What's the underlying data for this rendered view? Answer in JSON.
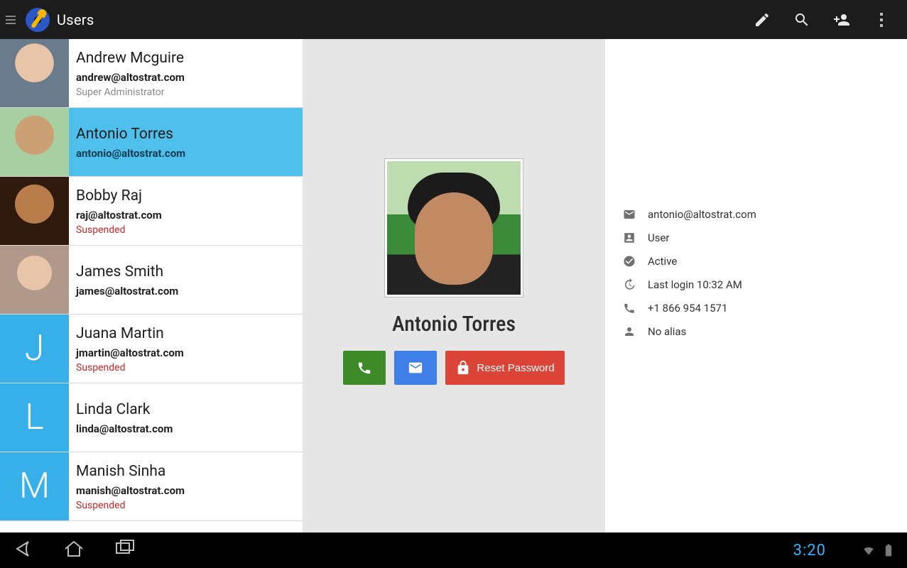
{
  "actionbar": {
    "title": "Users"
  },
  "users": [
    {
      "name": "Andrew Mcguire",
      "email": "andrew@altostrat.com",
      "role": "Super Administrator",
      "avatar_type": "photo",
      "avatar_letter": "",
      "face_class": "face1",
      "status": "",
      "selected": false
    },
    {
      "name": "Antonio Torres",
      "email": "antonio@altostrat.com",
      "role": "",
      "avatar_type": "photo",
      "avatar_letter": "",
      "face_class": "face2",
      "status": "",
      "selected": true
    },
    {
      "name": "Bobby Raj",
      "email": "raj@altostrat.com",
      "role": "",
      "avatar_type": "photo",
      "avatar_letter": "",
      "face_class": "face3",
      "status": "Suspended",
      "selected": false
    },
    {
      "name": "James Smith",
      "email": "james@altostrat.com",
      "role": "",
      "avatar_type": "photo",
      "avatar_letter": "",
      "face_class": "face4",
      "status": "",
      "selected": false
    },
    {
      "name": "Juana Martin",
      "email": "jmartin@altostrat.com",
      "role": "",
      "avatar_type": "letter",
      "avatar_letter": "J",
      "face_class": "",
      "status": "Suspended",
      "selected": false
    },
    {
      "name": "Linda Clark",
      "email": "linda@altostrat.com",
      "role": "",
      "avatar_type": "letter",
      "avatar_letter": "L",
      "face_class": "",
      "status": "",
      "selected": false
    },
    {
      "name": "Manish Sinha",
      "email": "manish@altostrat.com",
      "role": "",
      "avatar_type": "letter",
      "avatar_letter": "M",
      "face_class": "",
      "status": "Suspended",
      "selected": false
    }
  ],
  "detail": {
    "name": "Antonio Torres",
    "reset_label": "Reset Password",
    "meta": {
      "email": "antonio@altostrat.com",
      "role": "User",
      "status": "Active",
      "last_login": "Last login 10:32 AM",
      "phone": "+1 866 954 1571",
      "alias": "No alias"
    }
  },
  "system": {
    "clock": "3:20"
  }
}
